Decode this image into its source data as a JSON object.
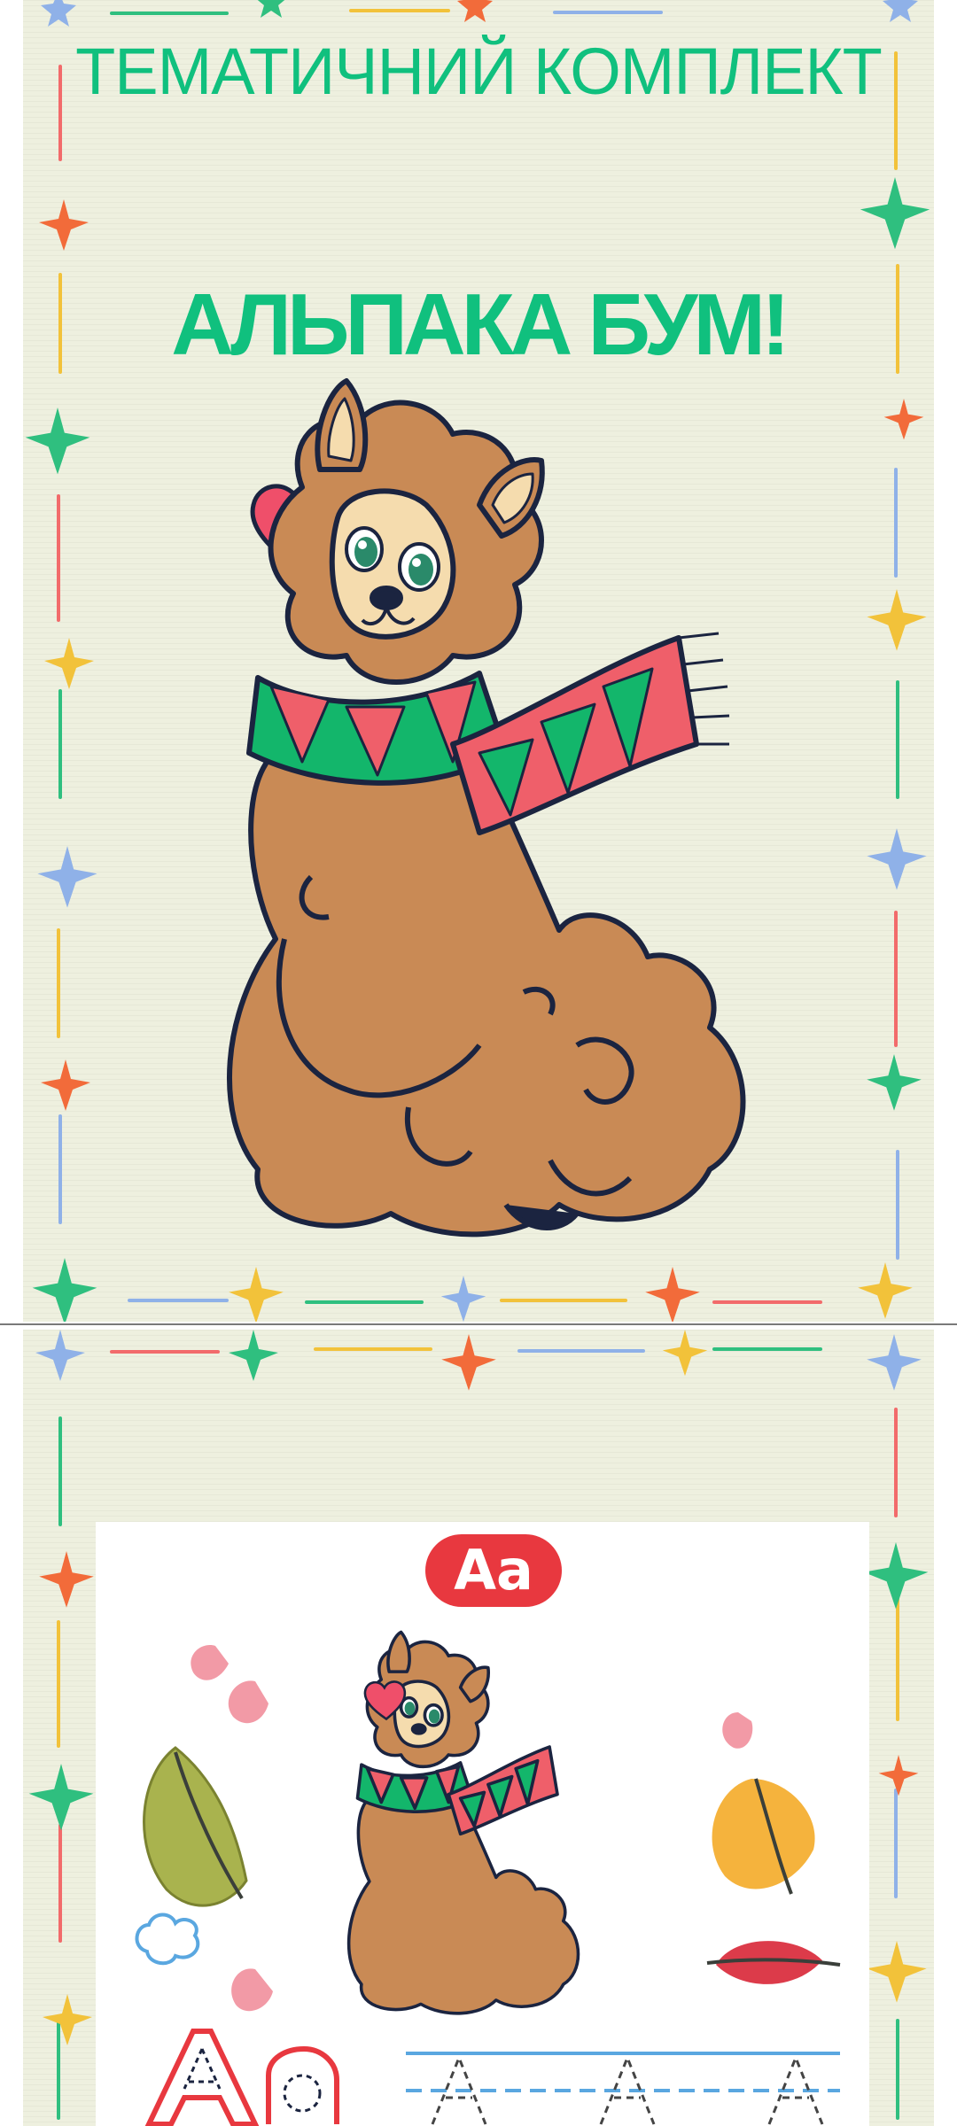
{
  "cover": {
    "series_title": "ТЕМАТИЧНИЙ КОМПЛЕКТ",
    "main_title": "АЛЬПАКА БУМ!",
    "illustration": "alpaca-with-scarf-illustration",
    "heart": "heart-icon"
  },
  "worksheet": {
    "letter_badge": "Aa",
    "illustration": "alpaca-with-scarf-illustration",
    "decorations": [
      "leaf-icon",
      "heart-icon",
      "cloud-icon"
    ],
    "tracing_letters": "Aa",
    "tracing_guides": "A A A"
  },
  "colors": {
    "background": "#eef0df",
    "title_green": "#10c07e",
    "badge_red": "#e8383f",
    "alpaca_brown": "#c98a55",
    "scarf_green": "#13b66b",
    "scarf_pink": "#ef5f6a"
  }
}
